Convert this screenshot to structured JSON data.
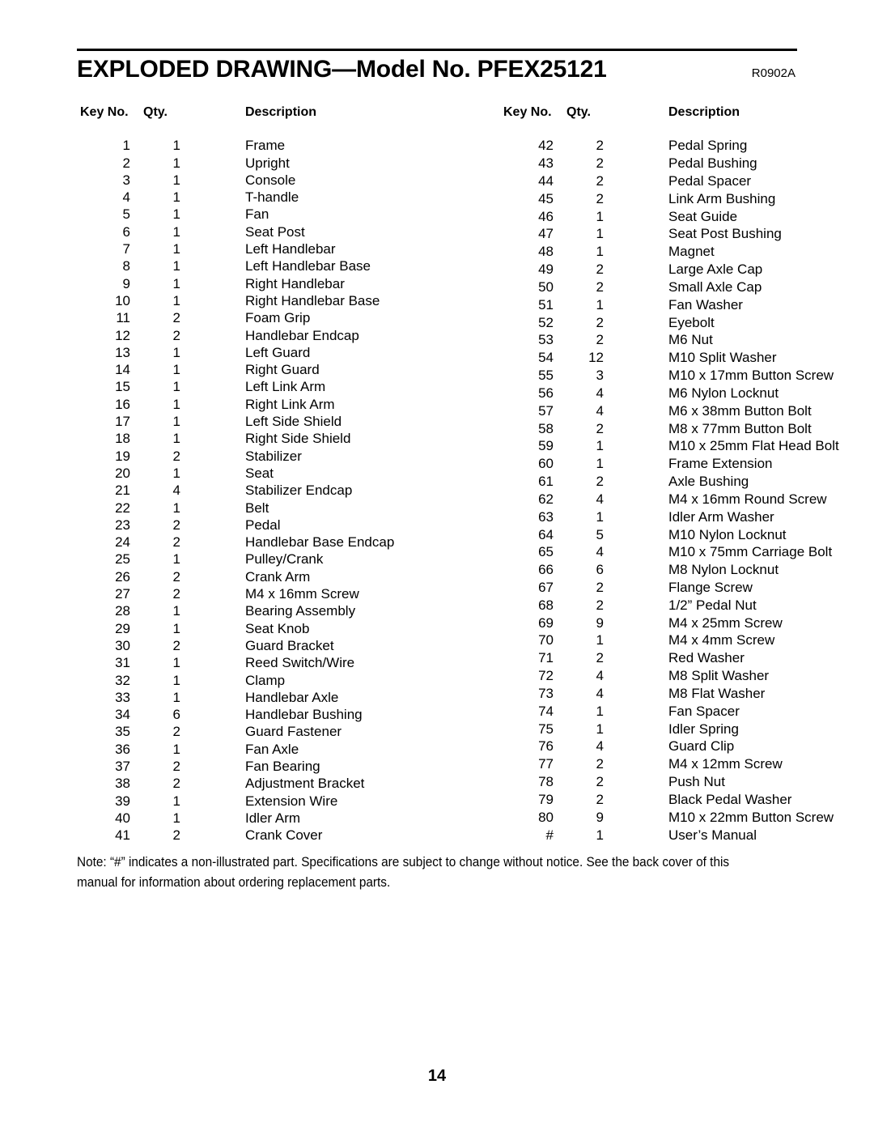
{
  "header": {
    "title": "EXPLODED DRAWING—Model No. PFEX25121",
    "revision": "R0902A"
  },
  "table": {
    "columns": {
      "key": "Key No.",
      "qty": "Qty.",
      "description": "Description"
    },
    "left_rows": [
      {
        "key": "1",
        "qty": "1",
        "description": "Frame"
      },
      {
        "key": "2",
        "qty": "1",
        "description": "Upright"
      },
      {
        "key": "3",
        "qty": "1",
        "description": "Console"
      },
      {
        "key": "4",
        "qty": "1",
        "description": "T-handle"
      },
      {
        "key": "5",
        "qty": "1",
        "description": "Fan"
      },
      {
        "key": "6",
        "qty": "1",
        "description": "Seat Post"
      },
      {
        "key": "7",
        "qty": "1",
        "description": "Left Handlebar"
      },
      {
        "key": "8",
        "qty": "1",
        "description": "Left Handlebar Base"
      },
      {
        "key": "9",
        "qty": "1",
        "description": "Right Handlebar"
      },
      {
        "key": "10",
        "qty": "1",
        "description": "Right Handlebar Base"
      },
      {
        "key": "11",
        "qty": "2",
        "description": "Foam Grip"
      },
      {
        "key": "12",
        "qty": "2",
        "description": "Handlebar Endcap"
      },
      {
        "key": "13",
        "qty": "1",
        "description": "Left Guard"
      },
      {
        "key": "14",
        "qty": "1",
        "description": "Right Guard"
      },
      {
        "key": "15",
        "qty": "1",
        "description": "Left Link Arm"
      },
      {
        "key": "16",
        "qty": "1",
        "description": "Right Link Arm"
      },
      {
        "key": "17",
        "qty": "1",
        "description": "Left Side Shield"
      },
      {
        "key": "18",
        "qty": "1",
        "description": "Right Side Shield"
      },
      {
        "key": "19",
        "qty": "2",
        "description": "Stabilizer"
      },
      {
        "key": "20",
        "qty": "1",
        "description": "Seat"
      },
      {
        "key": "21",
        "qty": "4",
        "description": "Stabilizer Endcap"
      },
      {
        "key": "22",
        "qty": "1",
        "description": "Belt"
      },
      {
        "key": "23",
        "qty": "2",
        "description": "Pedal"
      },
      {
        "key": "24",
        "qty": "2",
        "description": "Handlebar Base Endcap"
      },
      {
        "key": "25",
        "qty": "1",
        "description": "Pulley/Crank"
      },
      {
        "key": "26",
        "qty": "2",
        "description": "Crank Arm"
      },
      {
        "key": "27",
        "qty": "2",
        "description": "M4 x 16mm Screw"
      },
      {
        "key": "28",
        "qty": "1",
        "description": "Bearing Assembly"
      },
      {
        "key": "29",
        "qty": "1",
        "description": "Seat Knob"
      },
      {
        "key": "30",
        "qty": "2",
        "description": "Guard Bracket"
      },
      {
        "key": "31",
        "qty": "1",
        "description": "Reed Switch/Wire"
      },
      {
        "key": "32",
        "qty": "1",
        "description": "Clamp"
      },
      {
        "key": "33",
        "qty": "1",
        "description": "Handlebar Axle"
      },
      {
        "key": "34",
        "qty": "6",
        "description": "Handlebar Bushing"
      },
      {
        "key": "35",
        "qty": "2",
        "description": "Guard Fastener"
      },
      {
        "key": "36",
        "qty": "1",
        "description": "Fan Axle"
      },
      {
        "key": "37",
        "qty": "2",
        "description": "Fan Bearing"
      },
      {
        "key": "38",
        "qty": "2",
        "description": "Adjustment Bracket"
      },
      {
        "key": "39",
        "qty": "1",
        "description": "Extension Wire"
      },
      {
        "key": "40",
        "qty": "1",
        "description": "Idler Arm"
      },
      {
        "key": "41",
        "qty": "2",
        "description": "Crank Cover"
      }
    ],
    "right_rows": [
      {
        "key": "42",
        "qty": "2",
        "description": "Pedal Spring"
      },
      {
        "key": "43",
        "qty": "2",
        "description": "Pedal Bushing"
      },
      {
        "key": "44",
        "qty": "2",
        "description": "Pedal Spacer"
      },
      {
        "key": "45",
        "qty": "2",
        "description": "Link Arm Bushing"
      },
      {
        "key": "46",
        "qty": "1",
        "description": "Seat Guide"
      },
      {
        "key": "47",
        "qty": "1",
        "description": "Seat Post Bushing"
      },
      {
        "key": "48",
        "qty": "1",
        "description": "Magnet"
      },
      {
        "key": "49",
        "qty": "2",
        "description": "Large Axle Cap"
      },
      {
        "key": "50",
        "qty": "2",
        "description": "Small Axle Cap"
      },
      {
        "key": "51",
        "qty": "1",
        "description": "Fan Washer"
      },
      {
        "key": "52",
        "qty": "2",
        "description": "Eyebolt"
      },
      {
        "key": "53",
        "qty": "2",
        "description": "M6 Nut"
      },
      {
        "key": "54",
        "qty": "12",
        "description": "M10 Split Washer"
      },
      {
        "key": "55",
        "qty": "3",
        "description": "M10 x 17mm Button Screw"
      },
      {
        "key": "56",
        "qty": "4",
        "description": "M6 Nylon Locknut"
      },
      {
        "key": "57",
        "qty": "4",
        "description": "M6 x 38mm Button Bolt"
      },
      {
        "key": "58",
        "qty": "2",
        "description": "M8 x 77mm Button Bolt"
      },
      {
        "key": "59",
        "qty": "1",
        "description": "M10 x 25mm Flat Head Bolt"
      },
      {
        "key": "60",
        "qty": "1",
        "description": "Frame Extension"
      },
      {
        "key": "61",
        "qty": "2",
        "description": "Axle Bushing"
      },
      {
        "key": "62",
        "qty": "4",
        "description": "M4 x 16mm Round Screw"
      },
      {
        "key": "63",
        "qty": "1",
        "description": "Idler Arm Washer"
      },
      {
        "key": "64",
        "qty": "5",
        "description": "M10 Nylon Locknut"
      },
      {
        "key": "65",
        "qty": "4",
        "description": "M10 x 75mm Carriage Bolt"
      },
      {
        "key": "66",
        "qty": "6",
        "description": "M8 Nylon Locknut"
      },
      {
        "key": "67",
        "qty": "2",
        "description": "Flange Screw"
      },
      {
        "key": "68",
        "qty": "2",
        "description": "1/2” Pedal Nut"
      },
      {
        "key": "69",
        "qty": "9",
        "description": "M4 x 25mm Screw"
      },
      {
        "key": "70",
        "qty": "1",
        "description": "M4 x 4mm Screw"
      },
      {
        "key": "71",
        "qty": "2",
        "description": "Red Washer"
      },
      {
        "key": "72",
        "qty": "4",
        "description": "M8 Split Washer"
      },
      {
        "key": "73",
        "qty": "4",
        "description": "M8 Flat Washer"
      },
      {
        "key": "74",
        "qty": "1",
        "description": "Fan Spacer"
      },
      {
        "key": "75",
        "qty": "1",
        "description": "Idler Spring"
      },
      {
        "key": "76",
        "qty": "4",
        "description": "Guard Clip"
      },
      {
        "key": "77",
        "qty": "2",
        "description": "M4 x 12mm Screw"
      },
      {
        "key": "78",
        "qty": "2",
        "description": "Push Nut"
      },
      {
        "key": "79",
        "qty": "2",
        "description": "Black Pedal Washer"
      },
      {
        "key": "80",
        "qty": "9",
        "description": "M10 x 22mm Button Screw"
      },
      {
        "key": "#",
        "qty": "1",
        "description": "User’s Manual"
      }
    ]
  },
  "note": "Note: “#” indicates a non-illustrated part. Specifications are subject to change without notice. See the back cover of this manual for information about ordering replacement parts.",
  "page_number": "14"
}
